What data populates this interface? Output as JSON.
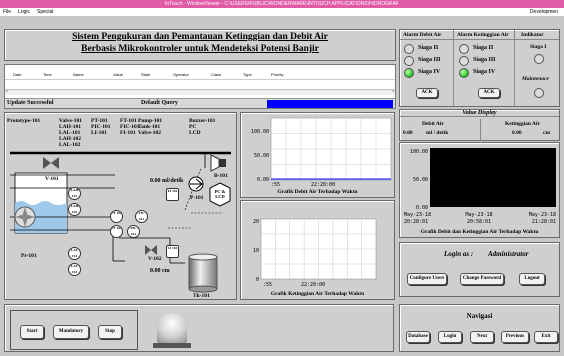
{
  "window": {
    "title": "InTouch - WindowViewer - C:\\USERS\\PUBLIC\\WONDERWARE\\INTOUCH APPLICATIONS\\HIDROGRAF"
  },
  "menu": {
    "items": [
      "File",
      "Logic",
      "Special"
    ],
    "right": "Developmen"
  },
  "page": {
    "title_line1": "Sistem Pengukuran dan Pemantauan Ketinggian dan Debit Air",
    "title_line2": "Berbasis Mikrokontroler untuk Mendeteksi Potensi Banjir"
  },
  "alarm_table": {
    "columns": [
      "Date",
      "Time",
      "Name",
      "Value",
      "State",
      "Operator",
      "Class",
      "Type",
      "Priority"
    ],
    "status_left": "Update Successful",
    "status_mid": "Default Query"
  },
  "alarms": {
    "debit_header": "Alarm Debit Air",
    "tinggi_header": "Alarm Ketinggian Air",
    "indikator_header": "Indikator",
    "debit_items": [
      {
        "label": "Siaga II",
        "on": false
      },
      {
        "label": "Siaga III",
        "on": false
      },
      {
        "label": "Siaga IV",
        "on": true
      }
    ],
    "tinggi_items": [
      {
        "label": "Siaga II",
        "on": false
      },
      {
        "label": "Siaga III",
        "on": false
      },
      {
        "label": "Siaga IV",
        "on": true
      }
    ],
    "ack": "ACK",
    "indikator_1": "Siaga I",
    "indikator_2": "Maintenace"
  },
  "value_display": {
    "title": "Value Display",
    "debit_label": "Debit Air",
    "debit_value": "0.00",
    "debit_unit": "ml / detik",
    "tinggi_label": "Ketinggian Air",
    "tinggi_value": "0.00",
    "tinggi_unit": "cm"
  },
  "legend": {
    "col1": [
      "Prototype-101",
      "Valve-101",
      "LAH-101",
      "LAL-101",
      "LAH-102",
      "LAL-102"
    ],
    "col2": [
      "PT-101",
      "PIC-101",
      "LI-101",
      "FT-101",
      "FIC-101",
      "FI-101"
    ],
    "col3": [
      "Pump-101",
      "Tank-101",
      "Valve-102",
      "Buzzer-101",
      "PC",
      "LCD"
    ]
  },
  "diagram": {
    "flow_value": "0.00 ml/detik",
    "level_value": "0.00 cm",
    "v101": "V-101",
    "v102": "V-102",
    "b101": "B-101",
    "p101": "P-101",
    "pc": "PC & LCD",
    "pr101": "Pr-101",
    "tk101": "Tk-101",
    "lah101": "LAH 101",
    "lah102": "LAH 102",
    "lal101": "LAL 101",
    "lal102": "LAL 102",
    "pt": "PT 101",
    "pic": "PIC 101",
    "ft": "FT 101",
    "fic": "FIC 101",
    "fi": "FI 101",
    "li": "LI 101"
  },
  "chart_debit": {
    "title": "Grafik Debit Air Terhadap Waktu",
    "y_ticks": [
      "100.00",
      "50.00",
      "0.00"
    ],
    "x_ticks": [
      ":55",
      "22:20:00"
    ]
  },
  "chart_tinggi": {
    "title": "Grafik Ketinggian Air Terhadap Waktu",
    "y_ticks": [
      "20",
      "10",
      "0"
    ],
    "x_ticks": [
      ":55",
      "22:20:00"
    ]
  },
  "chart_combined": {
    "title": "Grafik Debit dan Ketinggian Air Terhadap Waktu",
    "y_ticks": [
      "100.00",
      "50.00",
      "0.00"
    ],
    "x_ticks": [
      {
        "d": "May-23-18",
        "t": "20:28:01"
      },
      {
        "d": "May-23-18",
        "t": "20:58:01"
      },
      {
        "d": "May-23-18",
        "t": "21:28:01"
      }
    ]
  },
  "chart_data": [
    {
      "type": "line",
      "title": "Grafik Debit Air Terhadap Waktu",
      "x": [],
      "series": [],
      "ylim": [
        0,
        100
      ]
    },
    {
      "type": "line",
      "title": "Grafik Ketinggian Air Terhadap Waktu",
      "x": [],
      "series": [],
      "ylim": [
        0,
        20
      ]
    },
    {
      "type": "line",
      "title": "Grafik Debit dan Ketinggian Air Terhadap Waktu",
      "x": [],
      "series": [],
      "ylim": [
        0,
        100
      ]
    }
  ],
  "login": {
    "label": "Login as :",
    "user": "Administrator",
    "configure": "Configure Users",
    "change": "Change Password",
    "logout": "Logout"
  },
  "controls": {
    "start": "Start",
    "mandatory": "Mandatory",
    "stop": "Stop"
  },
  "navigasi": {
    "title": "Navigasi",
    "items": [
      "Database",
      "Login",
      "Next",
      "Previous",
      "Exit"
    ]
  },
  "colors": {
    "title_bar": "#e05aa6",
    "status_blue": "#0000ff",
    "lamp_on": "#2bd12b",
    "background": "#c8c8c8"
  }
}
